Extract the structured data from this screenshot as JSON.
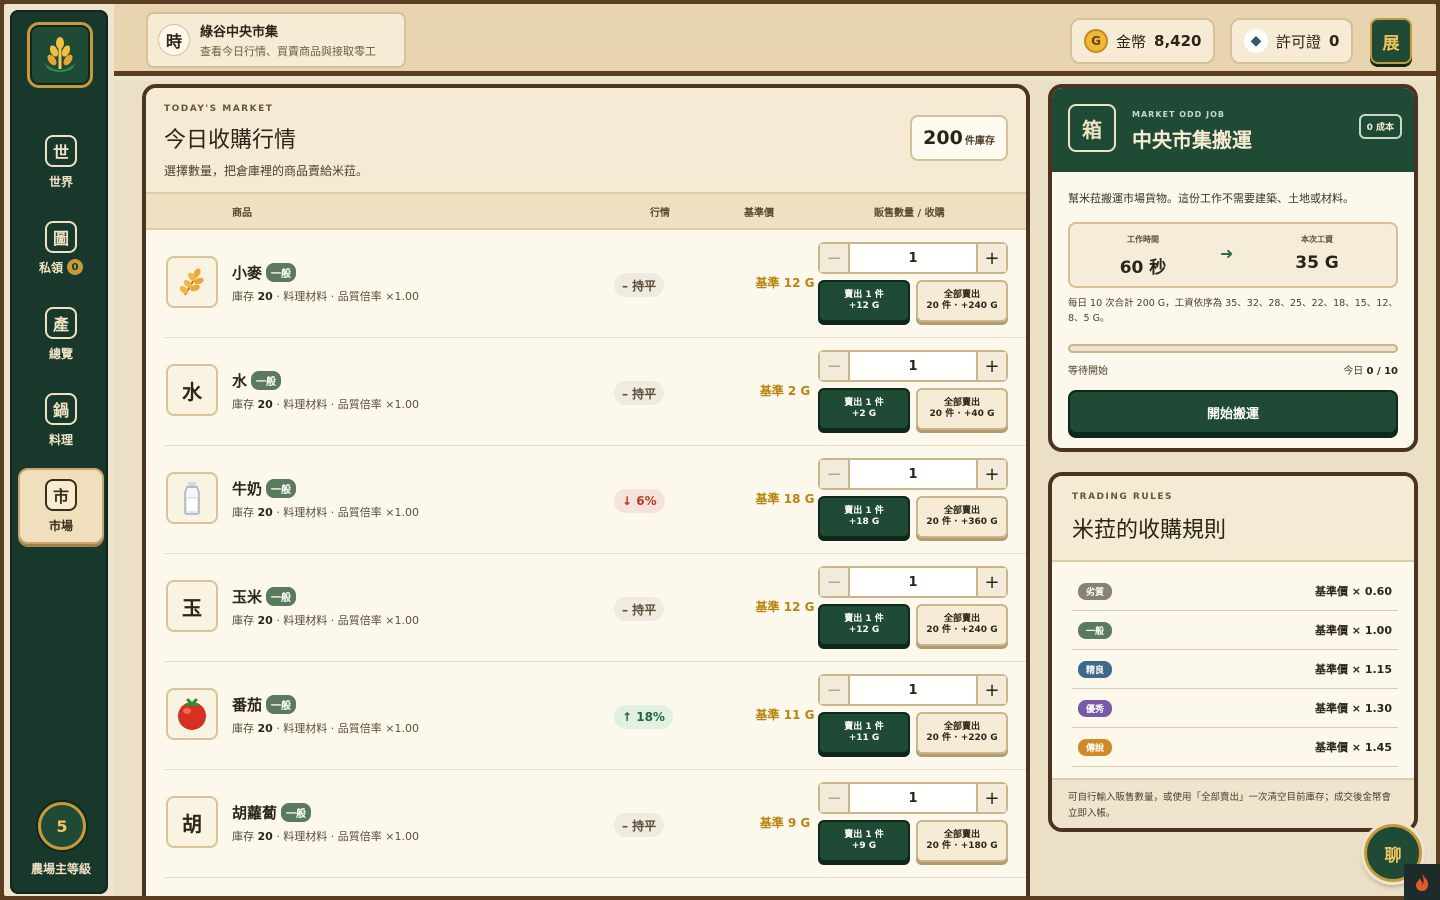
{
  "sidebar": {
    "logo_icon": "wheat-logo-icon",
    "items": [
      {
        "glyph": "世",
        "label": "世界"
      },
      {
        "glyph": "圖",
        "label": "私領",
        "badge": "0"
      },
      {
        "glyph": "產",
        "label": "總覽"
      },
      {
        "glyph": "鍋",
        "label": "料理"
      },
      {
        "glyph": "市",
        "label": "市場"
      }
    ],
    "level": {
      "value": "5",
      "label": "農場主等級"
    }
  },
  "header": {
    "glyph": "時",
    "title": "綠谷中央市集",
    "subtitle": "查看今日行情、買賣商品與接取零工",
    "gold_coin_glyph": "G",
    "gold_label": "金幣",
    "gold_value": "8,420",
    "permit_label": "許可證",
    "permit_value": "0",
    "expand_glyph": "展"
  },
  "market": {
    "eyebrow": "TODAY'S MARKET",
    "title": "今日收購行情",
    "subtitle": "選擇數量，把倉庫裡的商品賣給米菈。",
    "stock_count": "200",
    "stock_unit": "件庫存",
    "columns": {
      "product": "商品",
      "trend": "行情",
      "base": "基準價",
      "qty": "販售數量 / 收購"
    },
    "rows": [
      {
        "icon": "wheat-icon",
        "glyph": "",
        "name": "小麥",
        "grade": "一般",
        "stock_label": "庫存",
        "stock": "20",
        "meta": "· 料理材料 · 品質倍率 ×1.00",
        "trend_dir": "flat",
        "trend": "– 持平",
        "base": "基準 12 G",
        "qty": "1",
        "sell1_label": "賣出 1 件",
        "sell1_value": "+12 G",
        "sellall_label": "全部賣出",
        "sellall_value": "20 件 · +240 G"
      },
      {
        "icon": "water-icon",
        "glyph": "水",
        "name": "水",
        "grade": "一般",
        "stock_label": "庫存",
        "stock": "20",
        "meta": "· 料理材料 · 品質倍率 ×1.00",
        "trend_dir": "flat",
        "trend": "– 持平",
        "base": "基準 2 G",
        "qty": "1",
        "sell1_label": "賣出 1 件",
        "sell1_value": "+2 G",
        "sellall_label": "全部賣出",
        "sellall_value": "20 件 · +40 G"
      },
      {
        "icon": "milk-bottle-icon",
        "glyph": "",
        "name": "牛奶",
        "grade": "一般",
        "stock_label": "庫存",
        "stock": "20",
        "meta": "· 料理材料 · 品質倍率 ×1.00",
        "trend_dir": "down",
        "trend": "↓ 6%",
        "base": "基準 18 G",
        "qty": "1",
        "sell1_label": "賣出 1 件",
        "sell1_value": "+18 G",
        "sellall_label": "全部賣出",
        "sellall_value": "20 件 · +360 G"
      },
      {
        "icon": "corn-icon",
        "glyph": "玉",
        "name": "玉米",
        "grade": "一般",
        "stock_label": "庫存",
        "stock": "20",
        "meta": "· 料理材料 · 品質倍率 ×1.00",
        "trend_dir": "flat",
        "trend": "– 持平",
        "base": "基準 12 G",
        "qty": "1",
        "sell1_label": "賣出 1 件",
        "sell1_value": "+12 G",
        "sellall_label": "全部賣出",
        "sellall_value": "20 件 · +240 G"
      },
      {
        "icon": "tomato-icon",
        "glyph": "",
        "name": "番茄",
        "grade": "一般",
        "stock_label": "庫存",
        "stock": "20",
        "meta": "· 料理材料 · 品質倍率 ×1.00",
        "trend_dir": "up",
        "trend": "↑ 18%",
        "base": "基準 11 G",
        "qty": "1",
        "sell1_label": "賣出 1 件",
        "sell1_value": "+11 G",
        "sellall_label": "全部賣出",
        "sellall_value": "20 件 · +220 G"
      },
      {
        "icon": "carrot-icon",
        "glyph": "胡",
        "name": "胡蘿蔔",
        "grade": "一般",
        "stock_label": "庫存",
        "stock": "20",
        "meta": "· 料理材料 · 品質倍率 ×1.00",
        "trend_dir": "flat",
        "trend": "– 持平",
        "base": "基準 9 G",
        "qty": "1",
        "sell1_label": "賣出 1 件",
        "sell1_value": "+9 G",
        "sellall_label": "全部賣出",
        "sellall_value": "20 件 · +180 G"
      }
    ]
  },
  "job": {
    "glyph": "箱",
    "eyebrow": "MARKET ODD JOB",
    "title": "中央市集搬運",
    "cost": "0 成本",
    "desc": "幫米菈搬運市場貨物。這份工作不需要建築、土地或材料。",
    "time_label": "工作時間",
    "time_value": "60 秒",
    "pay_label": "本次工資",
    "pay_value": "35 G",
    "note": "每日 10 次合計 200 G，工資依序為 35、32、28、25、22、18、15、12、8、5 G。",
    "progress": 0,
    "status": "等待開始",
    "today_label": "今日",
    "today_value": "0 / 10",
    "start_label": "開始搬運"
  },
  "rules": {
    "eyebrow": "TRADING RULES",
    "title": "米菈的收購規則",
    "items": [
      {
        "grade": "劣質",
        "color": "#8a8173",
        "value": "基準價 × 0.60"
      },
      {
        "grade": "一般",
        "color": "#5a7a5e",
        "value": "基準價 × 1.00"
      },
      {
        "grade": "精良",
        "color": "#3f6a8c",
        "value": "基準價 × 1.15"
      },
      {
        "grade": "優秀",
        "color": "#7a58a8",
        "value": "基準價 × 1.30"
      },
      {
        "grade": "傳說",
        "color": "#d08a26",
        "value": "基準價 × 1.45"
      }
    ],
    "footer": "可自行輸入販售數量，或使用「全部賣出」一次清空目前庫存；成交後金幣會立即入帳。"
  },
  "chat_glyph": "聊",
  "colors": {
    "accent_green": "#1f4a35",
    "gold": "#c59a3a",
    "base_price": "#b88412",
    "trend_down": "#b83a22",
    "trend_up": "#1f6a3a"
  }
}
